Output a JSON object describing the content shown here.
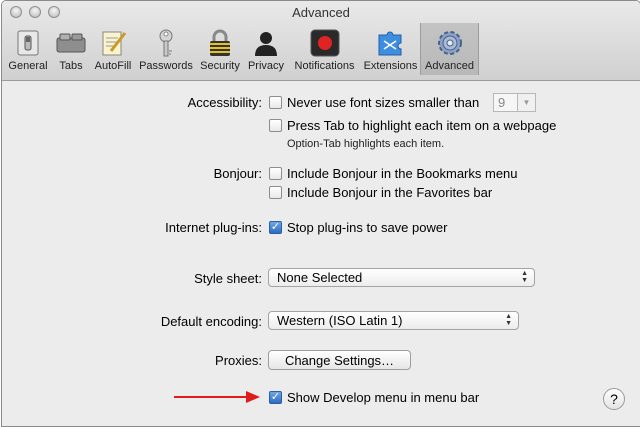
{
  "window": {
    "title": "Advanced"
  },
  "toolbar": {
    "items": [
      {
        "label": "General",
        "icon": "general-switch-icon"
      },
      {
        "label": "Tabs",
        "icon": "tabs-icon"
      },
      {
        "label": "AutoFill",
        "icon": "autofill-icon"
      },
      {
        "label": "Passwords",
        "icon": "key-icon"
      },
      {
        "label": "Security",
        "icon": "padlock-icon"
      },
      {
        "label": "Privacy",
        "icon": "silhouette-icon"
      },
      {
        "label": "Notifications",
        "icon": "notification-icon"
      },
      {
        "label": "Extensions",
        "icon": "puzzle-icon"
      },
      {
        "label": "Advanced",
        "icon": "gears-icon"
      }
    ],
    "active": "Advanced"
  },
  "accessibility": {
    "label": "Accessibility:",
    "min_font_label": "Never use font sizes smaller than",
    "min_font_value": "9",
    "press_tab_label": "Press Tab to highlight each item on a webpage",
    "note": "Option-Tab highlights each item."
  },
  "bonjour": {
    "label": "Bonjour:",
    "bookmarks_menu_label": "Include Bonjour in the Bookmarks menu",
    "favorites_bar_label": "Include Bonjour in the Favorites bar"
  },
  "plugins": {
    "label": "Internet plug-ins:",
    "stop_plugins_label": "Stop plug-ins to save power",
    "stop_plugins_checked": true
  },
  "stylesheet": {
    "label": "Style sheet:",
    "value": "None Selected"
  },
  "encoding": {
    "label": "Default encoding:",
    "value": "Western (ISO Latin 1)"
  },
  "proxies": {
    "label": "Proxies:",
    "button_label": "Change Settings…"
  },
  "develop": {
    "label": "Show Develop menu in menu bar",
    "checked": true
  },
  "help": {
    "label": "?"
  },
  "colors": {
    "accent": "#2b6cc4",
    "arrow": "#e01b1b"
  }
}
